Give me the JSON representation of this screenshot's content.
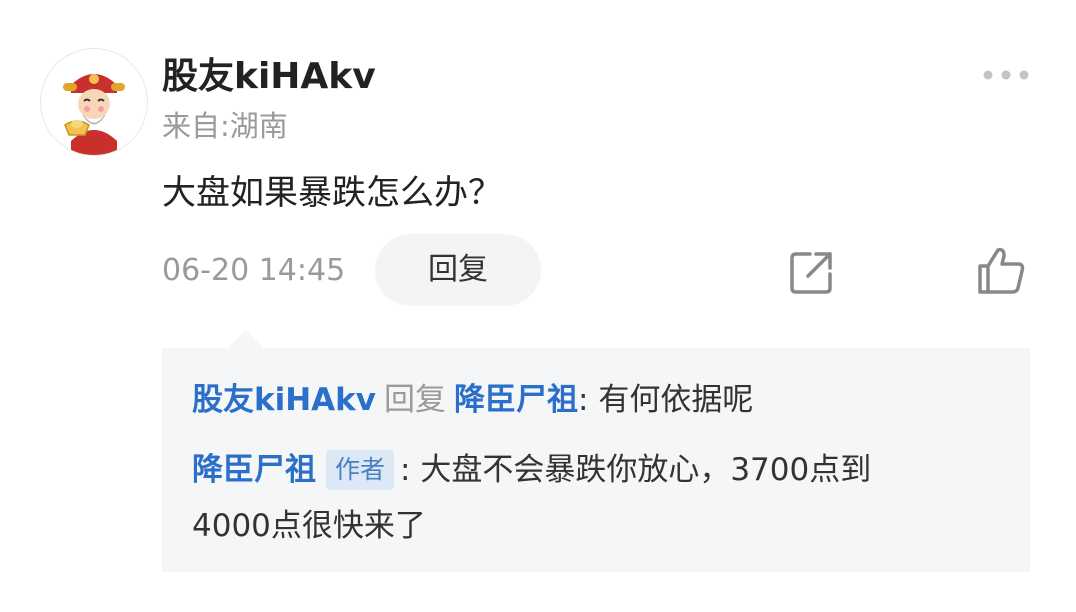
{
  "comment": {
    "username": "股友kiHAkv",
    "location": "来自:湖南",
    "text": "大盘如果暴跌怎么办？",
    "timestamp": "06-20 14:45",
    "reply_label": "回复",
    "icons": {
      "more": "more-dots-icon",
      "share": "share-icon",
      "like": "thumbs-up-icon",
      "avatar": "fortune-god-avatar"
    }
  },
  "replies": [
    {
      "from": "股友kiHAkv",
      "reply_word": "回复",
      "to": "降臣尸祖",
      "text": ": 有何依据呢"
    },
    {
      "from": "降臣尸祖",
      "badge": "作者",
      "text_line1": ": 大盘不会暴跌你放心，3700点到",
      "text_line2": "4000点很快来了"
    }
  ],
  "colors": {
    "link": "#2a6fc9",
    "muted": "#9a9a9a",
    "text": "#222222",
    "reply_bg": "#f5f6f7",
    "badge_bg": "#dde8f7",
    "button_bg": "#f4f4f5"
  }
}
